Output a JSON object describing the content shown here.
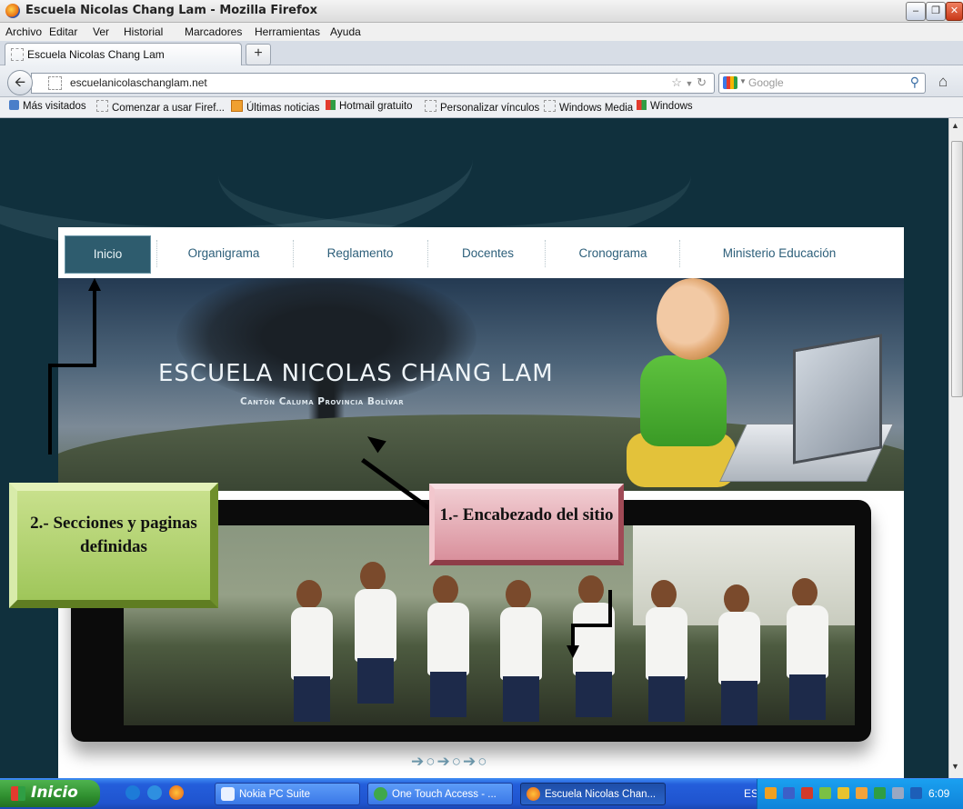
{
  "window": {
    "title": "Escuela Nicolas Chang Lam - Mozilla Firefox"
  },
  "menu": [
    "Archivo",
    "Editar",
    "Ver",
    "Historial",
    "Marcadores",
    "Herramientas",
    "Ayuda"
  ],
  "tab": {
    "label": "Escuela Nicolas Chang Lam",
    "new_tab": "+"
  },
  "nav": {
    "url": "escuelanicolaschanglam.net",
    "search_placeholder": "Google"
  },
  "bookmarks": [
    "Más visitados",
    "Comenzar a usar Firef...",
    "Últimas noticias",
    "Hotmail gratuito",
    "Personalizar vínculos",
    "Windows Media",
    "Windows"
  ],
  "site": {
    "menu": [
      "Inicio",
      "Organigrama",
      "Reglamento",
      "Docentes",
      "Cronograma",
      "Ministerio Educación"
    ],
    "active_menu": "Inicio",
    "title": "ESCUELA NICOLAS CHANG LAM",
    "subtitle": "Cantón Caluma Provincia Bolívar",
    "slider_indicator": "➔○➔○➔○"
  },
  "annotations": {
    "header": "1.- Encabezado del sitio",
    "sections": "2.- Secciones y paginas definidas"
  },
  "taskbar": {
    "start": "Inicio",
    "items": [
      "Nokia PC Suite",
      "One Touch Access - ...",
      "Escuela Nicolas Chan..."
    ],
    "language": "ES",
    "clock": "6:09"
  },
  "colors": {
    "page_bg": "#10303d",
    "nav_active": "#2e5c6e",
    "nav_text": "#2d5f7a",
    "taskbar": "#245edb"
  },
  "icons": [
    "firefox-icon",
    "back-arrow-icon",
    "star-icon",
    "reload-icon",
    "search-icon",
    "home-icon",
    "windows-flag-icon"
  ]
}
